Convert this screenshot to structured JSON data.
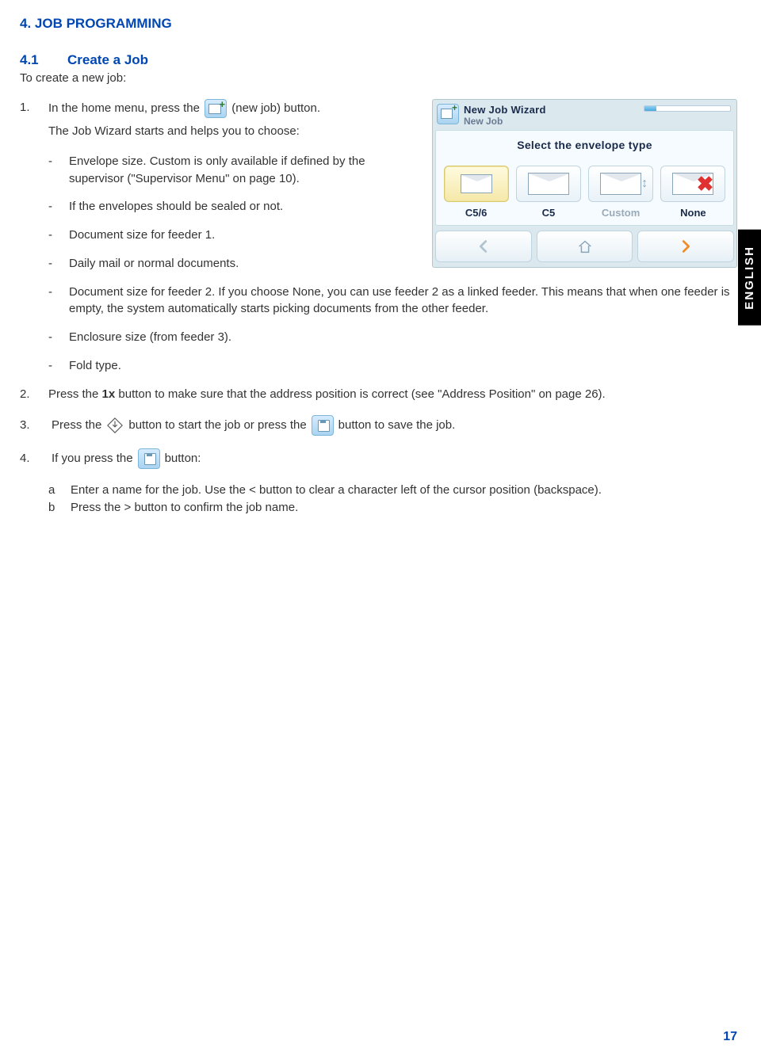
{
  "heading": "4.   JOB PROGRAMMING",
  "sub_num": "4.1",
  "sub_title": "Create a Job",
  "intro": "To create a new job:",
  "step1_a": "In the home menu, press the",
  "step1_b": "(new job) button.",
  "step1_c": "The Job Wizard starts and helps you to choose:",
  "bullets": {
    "b1": "Envelope size. Custom is only available if defined by the supervisor (\"Supervisor Menu\" on page 10).",
    "b2": "If the envelopes should be sealed or not.",
    "b3": "Document size for feeder 1.",
    "b4": "Daily mail or normal documents.",
    "b5": "Document size for feeder 2. If you choose None, you can use feeder 2 as a linked feeder. This means that when one feeder is empty, the system automatically starts picking documents from the other feeder.",
    "b6": "Enclosure size (from feeder 3).",
    "b7": "Fold type."
  },
  "step2_a": "Press the ",
  "step2_bold": "1x",
  "step2_b": " button to make sure that the address position is correct (see \"Address Position\" on page 26).",
  "step3_a": "Press the",
  "step3_b": "button to start the job or press the",
  "step3_c": "button to save the job.",
  "step4_a": "If you press the",
  "step4_b": "button:",
  "step4_sa": "Enter a name for the job. Use the < button to clear a character left of the cursor position (backspace).",
  "step4_sb": "Press the > button to confirm the job name.",
  "wizard": {
    "title1": "New Job Wizard",
    "title2": "New Job",
    "prompt": "Select the envelope type",
    "opt1": "C5/6",
    "opt2": "C5",
    "opt3": "Custom",
    "opt4": "None"
  },
  "side_label": "ENGLISH",
  "page_num": "17",
  "nums": {
    "n1": "1.",
    "n2": "2.",
    "n3": "3.",
    "n4": "4.",
    "la": "a",
    "lb": "b"
  }
}
